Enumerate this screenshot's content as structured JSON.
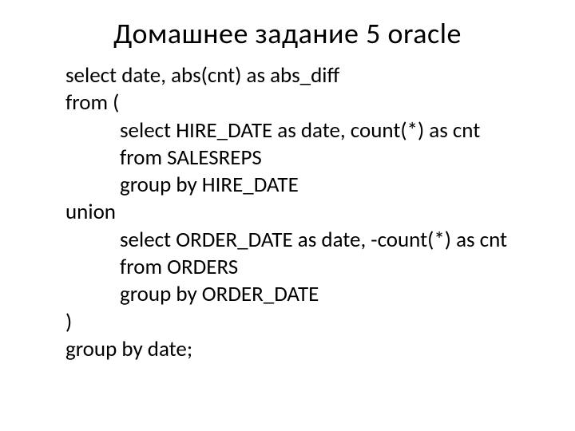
{
  "title": "Домашнее задание 5 oracle",
  "code": {
    "l1": "select date, abs(cnt) as abs_diff",
    "l2": "from (",
    "l3": "select HIRE_DATE as date, count(*) as cnt",
    "l4": "from SALESREPS",
    "l5": "group by HIRE_DATE",
    "l6": "union",
    "l7": "select ORDER_DATE as date, -count(*) as cnt",
    "l8": "from ORDERS",
    "l9": "group by ORDER_DATE",
    "l10": ")",
    "l11": "group by date;"
  }
}
